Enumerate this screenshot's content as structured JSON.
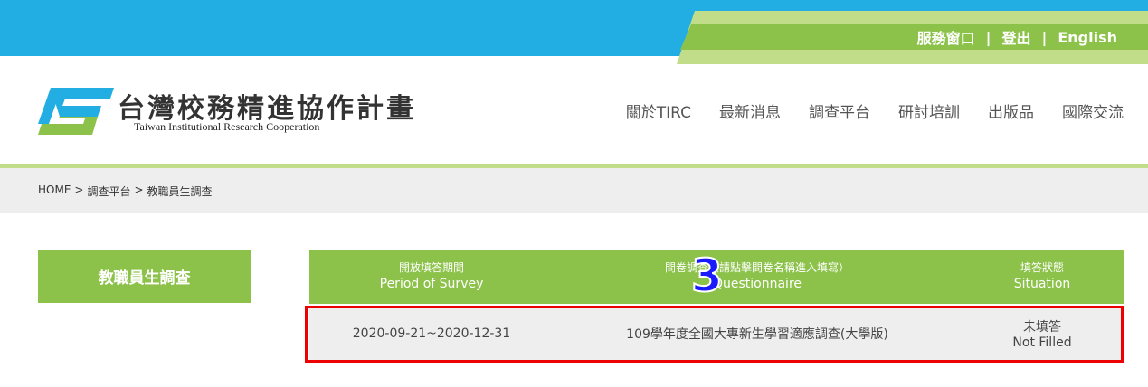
{
  "top_links": {
    "service": "服務窗口",
    "logout": "登出",
    "english": "English",
    "separator": "|"
  },
  "logo": {
    "title": "台灣校務精進協作計畫",
    "subtitle": "Taiwan Institutional Research Cooperation"
  },
  "nav": [
    "關於TIRC",
    "最新消息",
    "調查平台",
    "研討培訓",
    "出版品",
    "國際交流"
  ],
  "breadcrumb": [
    "HOME",
    "調查平台",
    "教職員生調查"
  ],
  "breadcrumb_sep": ">",
  "sidebar": {
    "active_tab": "教職員生調查"
  },
  "table": {
    "headers": [
      {
        "zh": "開放填答期間",
        "en": "Period of Survey"
      },
      {
        "zh": "問卷調查（請點擊問卷名稱進入填寫）",
        "en": "Questionnaire"
      },
      {
        "zh": "填答狀態",
        "en": "Situation"
      }
    ],
    "rows": [
      {
        "period": "2020-09-21~2020-12-31",
        "questionnaire": "109學年度全國大專新生學習適應調查(大學版)",
        "status_zh": "未填答",
        "status_en": "Not Filled"
      }
    ]
  },
  "annotation": {
    "step_number": "3"
  },
  "colors": {
    "top_blue": "#22aee2",
    "green": "#8cc24a",
    "light_green": "#c2dd8a",
    "highlight_red": "#ee0000",
    "badge_blue": "#1a1aff"
  }
}
